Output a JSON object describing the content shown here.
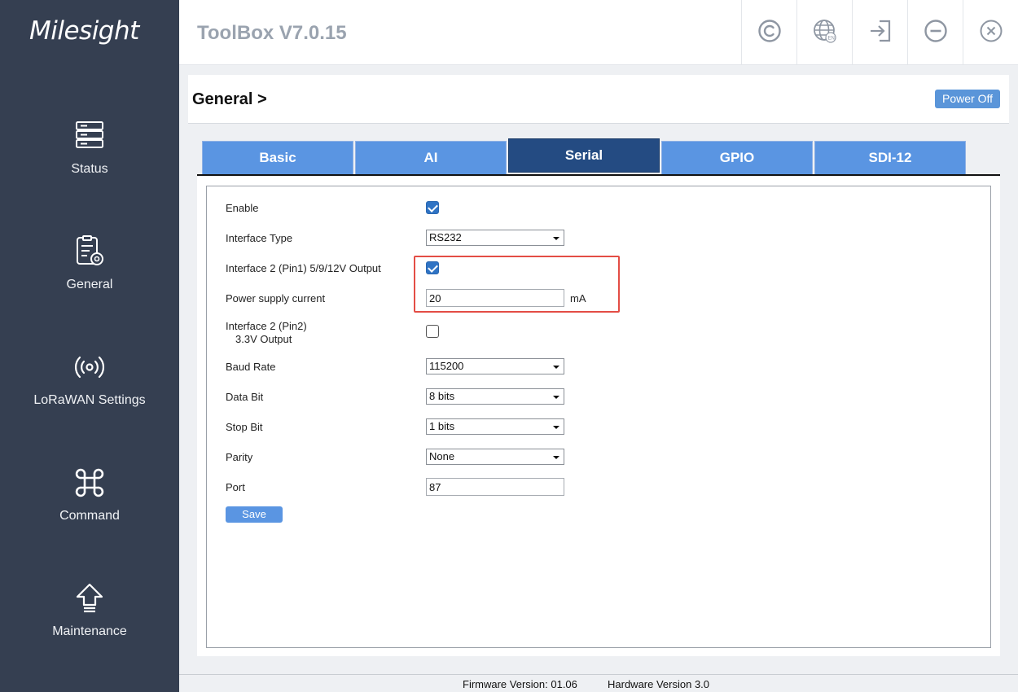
{
  "brand": {
    "logo_text": "Milesight"
  },
  "header": {
    "app_title": "ToolBox V7.0.15"
  },
  "header_buttons": [
    "copyright-icon",
    "language-globe-icon",
    "logout-icon",
    "minimize-icon",
    "close-icon"
  ],
  "sidebar": {
    "items": [
      {
        "label": "Status",
        "icon": "status-server-icon"
      },
      {
        "label": "General",
        "icon": "general-clipboard-gear-icon"
      },
      {
        "label": "LoRaWAN Settings",
        "icon": "wireless-signal-icon"
      },
      {
        "label": "Command",
        "icon": "command-key-icon"
      },
      {
        "label": "Maintenance",
        "icon": "upload-arrow-icon"
      }
    ]
  },
  "page": {
    "title": "General >",
    "power_button": "Power Off"
  },
  "tabs": [
    {
      "label": "Basic",
      "active": false
    },
    {
      "label": "AI",
      "active": false
    },
    {
      "label": "Serial",
      "active": true
    },
    {
      "label": "GPIO",
      "active": false
    },
    {
      "label": "SDI-12",
      "active": false
    }
  ],
  "form": {
    "enable": {
      "label": "Enable",
      "checked": true
    },
    "interface_type": {
      "label": "Interface Type",
      "value": "RS232"
    },
    "pin1_output": {
      "label": "Interface 2 (Pin1) 5/9/12V Output",
      "checked": true
    },
    "power_supply_current": {
      "label": "Power supply current",
      "value": "20",
      "unit": "mA"
    },
    "pin2_output": {
      "label_line1": "Interface 2 (Pin2)",
      "label_line2": "3.3V Output",
      "checked": false
    },
    "baud_rate": {
      "label": "Baud Rate",
      "value": "115200"
    },
    "data_bit": {
      "label": "Data Bit",
      "value": "8 bits"
    },
    "stop_bit": {
      "label": "Stop Bit",
      "value": "1 bits"
    },
    "parity": {
      "label": "Parity",
      "value": "None"
    },
    "port": {
      "label": "Port",
      "value": "87"
    },
    "save_label": "Save"
  },
  "footer": {
    "firmware": "Firmware Version:  01.06",
    "hardware": "Hardware Version  3.0"
  },
  "colors": {
    "sidebar_bg": "#353f51",
    "tab_active": "#244b82",
    "tab_inactive": "#5a95e2",
    "checkbox_on": "#2f73c4",
    "highlight_border": "#e34d45"
  }
}
